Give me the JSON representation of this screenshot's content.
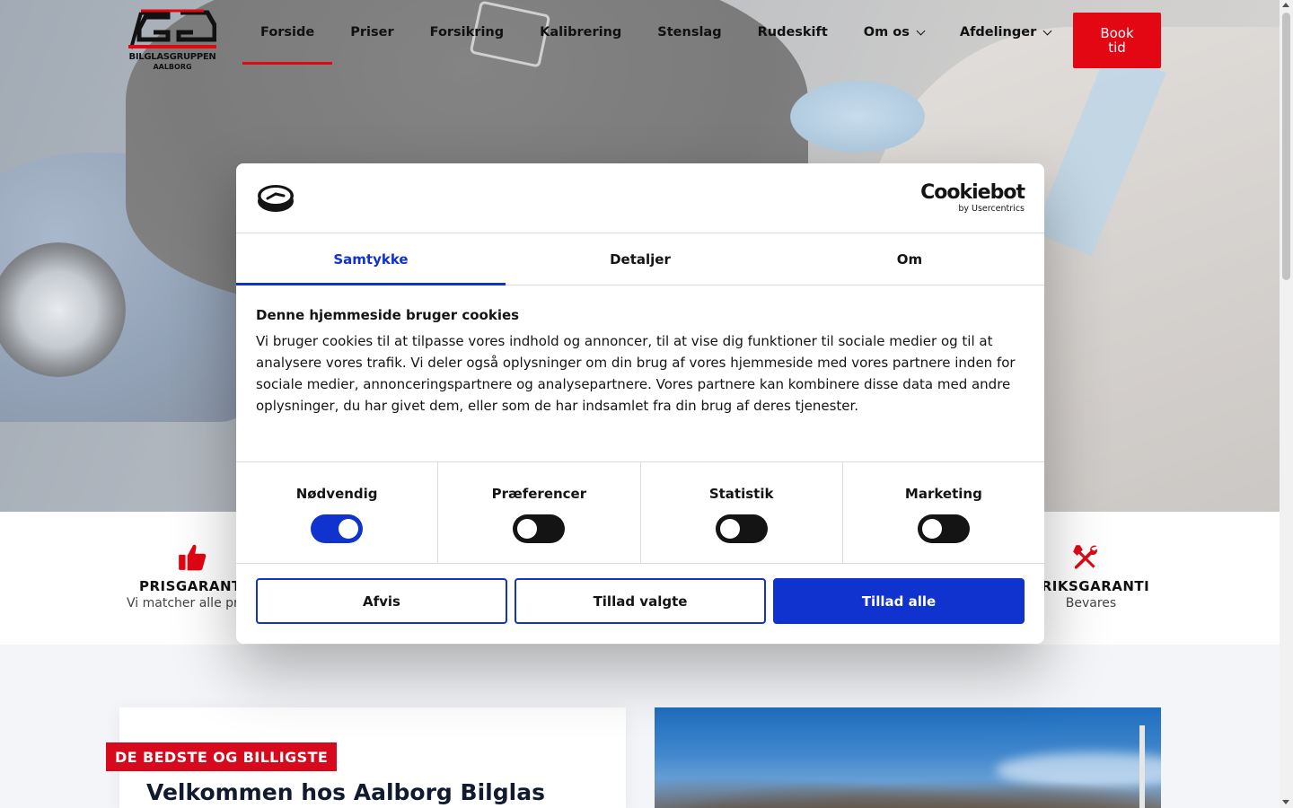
{
  "header": {
    "logo_name": "BILGLASGRUPPEN",
    "logo_city": "AALBORG",
    "nav": [
      {
        "label": "Forside",
        "active": true,
        "dropdown": false
      },
      {
        "label": "Priser",
        "active": false,
        "dropdown": false
      },
      {
        "label": "Forsikring",
        "active": false,
        "dropdown": false
      },
      {
        "label": "Kalibrering",
        "active": false,
        "dropdown": false
      },
      {
        "label": "Stenslag",
        "active": false,
        "dropdown": false
      },
      {
        "label": "Rudeskift",
        "active": false,
        "dropdown": false
      },
      {
        "label": "Om os",
        "active": false,
        "dropdown": true
      },
      {
        "label": "Afdelinger",
        "active": false,
        "dropdown": true
      }
    ],
    "book_label": "Book\ntid"
  },
  "features": [
    {
      "icon": "thumbs-up-icon",
      "title": "PRISGARANTI",
      "subtitle": "Vi matcher alle pr"
    },
    {
      "icon": "wrench-screwdriver-icon",
      "title": "RIKSGARANTI",
      "subtitle": "Bevares"
    }
  ],
  "welcome": {
    "tag": "DE BEDSTE OG BILLIGSTE",
    "title": "Velkommen hos Aalborg Bilglas"
  },
  "cookie_dialog": {
    "brand_name": "Cookiebot",
    "brand_by": "by Usercentrics",
    "tabs": [
      {
        "label": "Samtykke",
        "active": true
      },
      {
        "label": "Detaljer",
        "active": false
      },
      {
        "label": "Om",
        "active": false
      }
    ],
    "heading": "Denne hjemmeside bruger cookies",
    "text": "Vi bruger cookies til at tilpasse vores indhold og annoncer, til at vise dig funktioner til sociale medier og til at analysere vores trafik. Vi deler også oplysninger om din brug af vores hjemmeside med vores partnere inden for sociale medier, annonceringspartnere og analysepartnere. Vores partnere kan kombinere disse data med andre oplysninger, du har givet dem, eller som de har indsamlet fra din brug af deres tjenester.",
    "consents": [
      {
        "label": "Nødvendig",
        "enabled": true
      },
      {
        "label": "Præferencer",
        "enabled": false
      },
      {
        "label": "Statistik",
        "enabled": false
      },
      {
        "label": "Marketing",
        "enabled": false
      }
    ],
    "buttons": {
      "deny": "Afvis",
      "allow_selected": "Tillad valgte",
      "allow_all": "Tillad alle"
    }
  },
  "colors": {
    "brand_red": "#e30613",
    "cookie_blue": "#1032cf"
  }
}
